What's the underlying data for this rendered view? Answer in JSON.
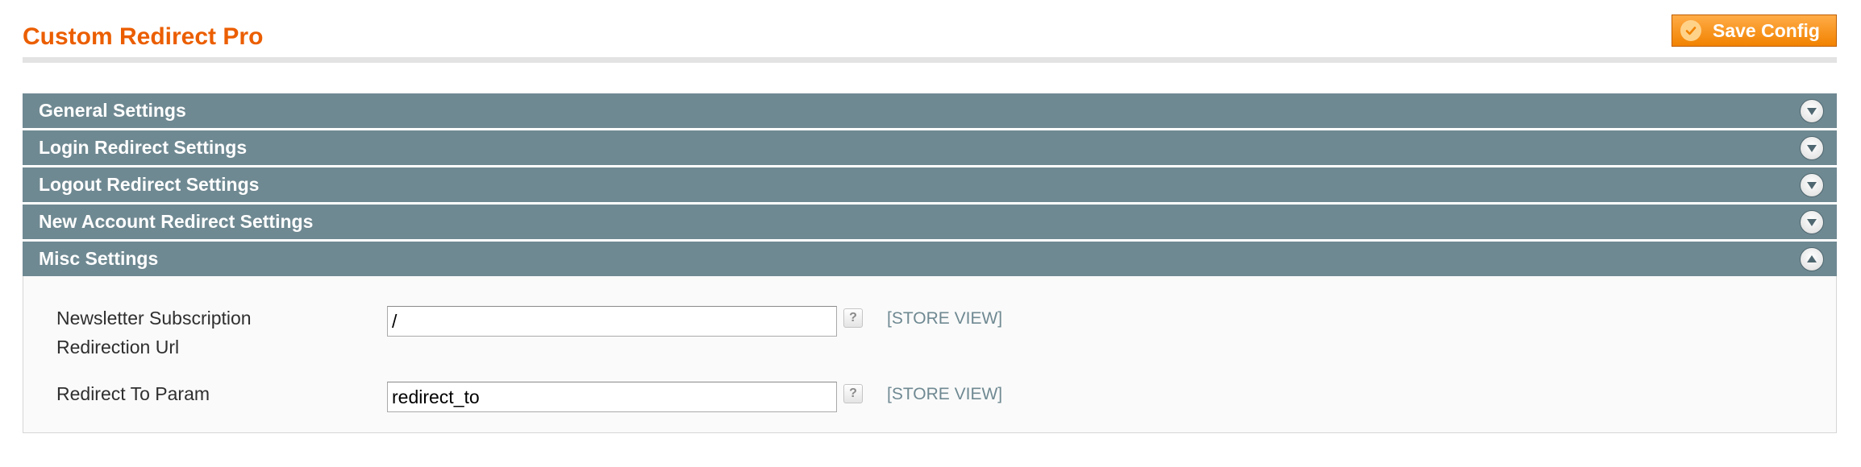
{
  "header": {
    "title": "Custom Redirect Pro",
    "save_label": "Save Config"
  },
  "sections": [
    {
      "label": "General Settings",
      "expanded": false
    },
    {
      "label": "Login Redirect Settings",
      "expanded": false
    },
    {
      "label": "Logout Redirect Settings",
      "expanded": false
    },
    {
      "label": "New Account Redirect Settings",
      "expanded": false
    },
    {
      "label": "Misc Settings",
      "expanded": true
    }
  ],
  "misc": {
    "fields": [
      {
        "label_line1": "Newsletter Subscription",
        "label_line2": "Redirection Url",
        "value": "/",
        "help": "?",
        "scope": "[STORE VIEW]"
      },
      {
        "label_line1": "Redirect To Param",
        "value": "redirect_to",
        "help": "?",
        "scope": "[STORE VIEW]"
      }
    ]
  },
  "icons": {
    "save": "check-circle-icon",
    "collapsed": "chevron-down-icon",
    "expanded": "chevron-up-icon"
  },
  "colors": {
    "title": "#eb5e00",
    "section_header": "#6f8992",
    "button": "#f18200",
    "scope": "#6f8992"
  }
}
